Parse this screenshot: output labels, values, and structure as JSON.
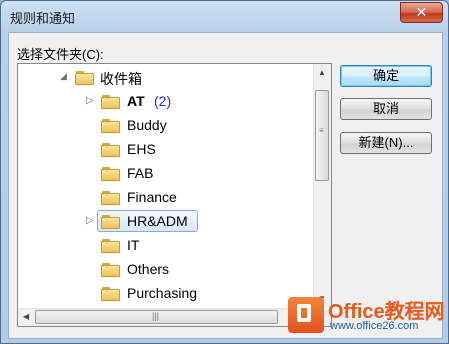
{
  "window": {
    "title": "规则和通知",
    "close_glyph": "✕"
  },
  "dialog": {
    "folder_label": "选择文件夹(C):"
  },
  "tree": {
    "root": {
      "label": "收件箱",
      "expanded": true
    },
    "items": [
      {
        "label": "AT",
        "count": "(2)",
        "bold": true,
        "expandable": true
      },
      {
        "label": "Buddy",
        "count": "",
        "bold": false,
        "expandable": false
      },
      {
        "label": "EHS",
        "count": "",
        "bold": false,
        "expandable": false
      },
      {
        "label": "FAB",
        "count": "",
        "bold": false,
        "expandable": false
      },
      {
        "label": "Finance",
        "count": "",
        "bold": false,
        "expandable": false
      },
      {
        "label": "HR&ADM",
        "count": "",
        "bold": false,
        "expandable": true,
        "selected": true
      },
      {
        "label": "IT",
        "count": "",
        "bold": false,
        "expandable": false
      },
      {
        "label": "Others",
        "count": "",
        "bold": false,
        "expandable": false
      },
      {
        "label": "Purchasing",
        "count": "",
        "bold": false,
        "expandable": false
      }
    ]
  },
  "buttons": {
    "ok": "确定",
    "cancel": "取消",
    "new": "新建(N)..."
  },
  "watermark": {
    "brand": "Office教程网",
    "site": "www.office26.com"
  },
  "colors": {
    "accent": "#3c7fb1",
    "count": "#1d31c9",
    "brand": "#e85a1c"
  }
}
